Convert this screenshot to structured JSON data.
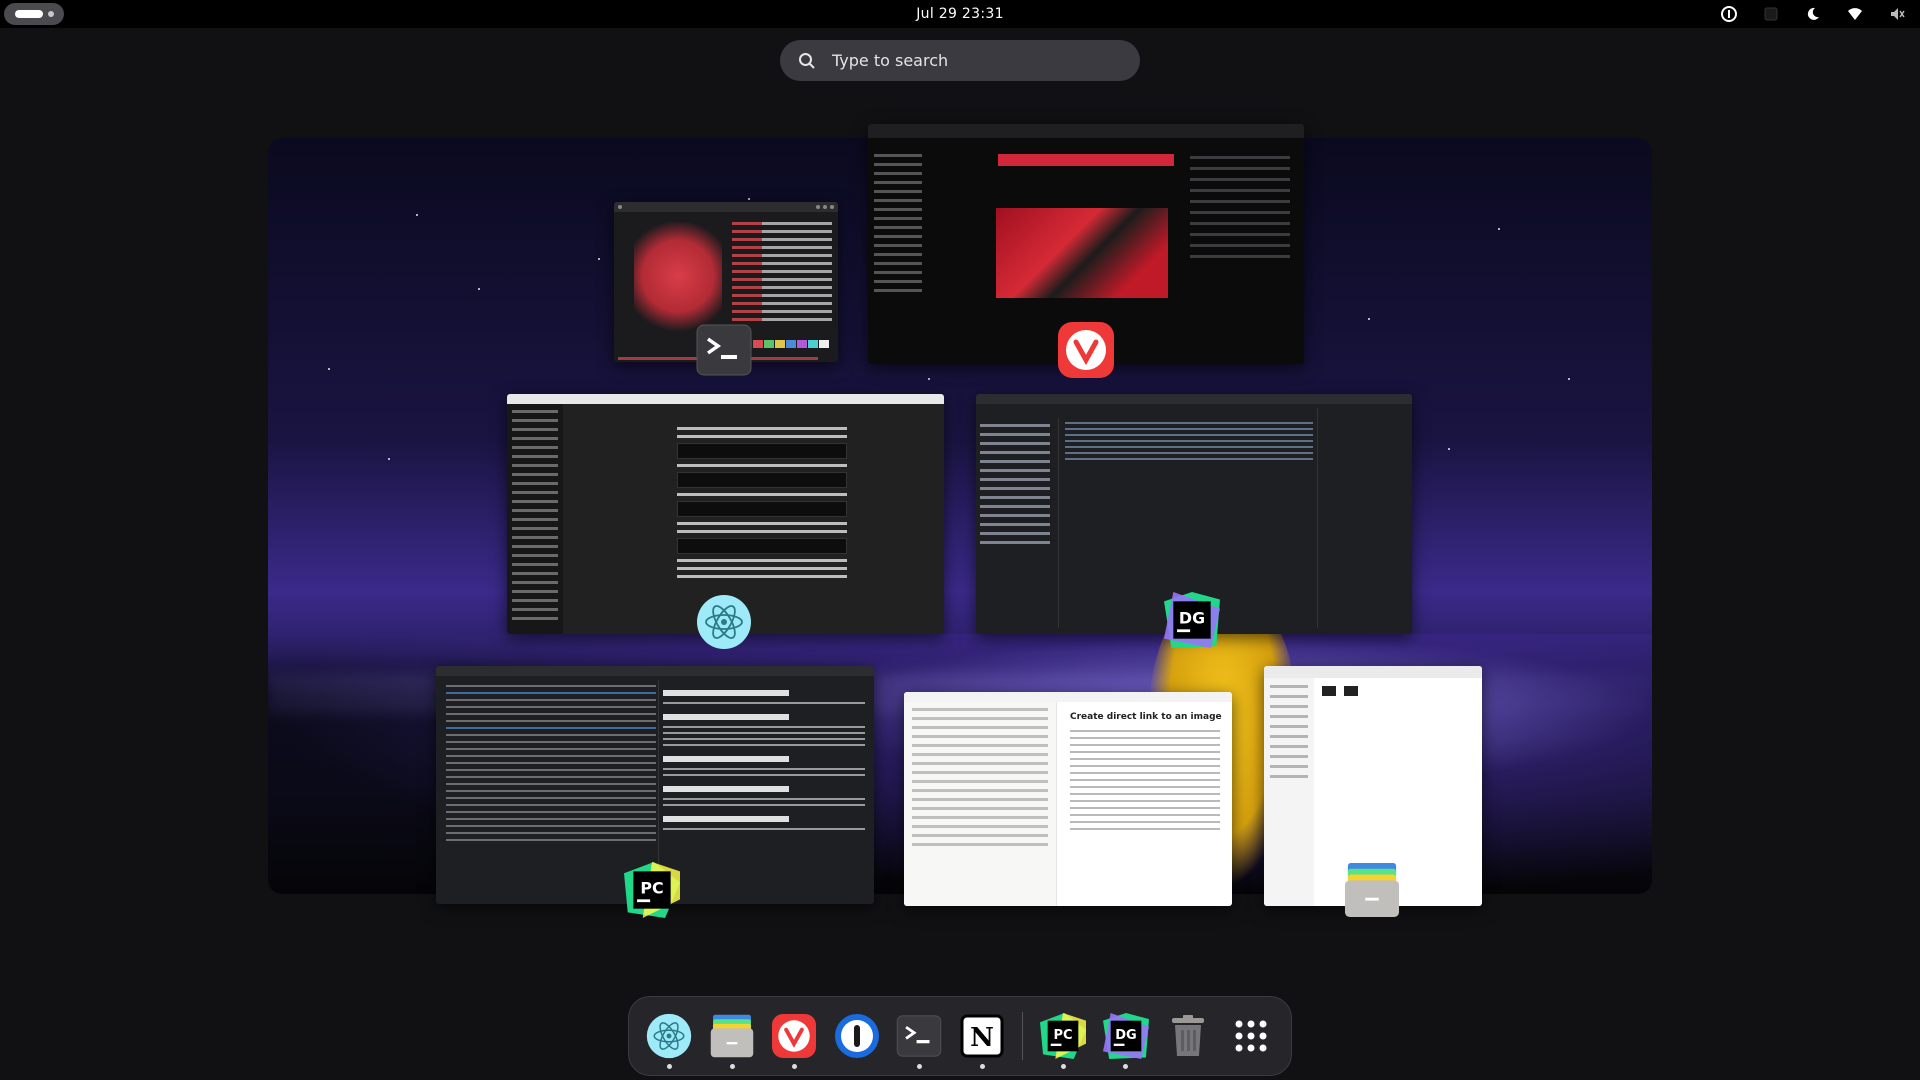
{
  "topbar": {
    "clock": "Jul 29  23:31",
    "tray_icons": [
      "password-manager-icon",
      "app-indicator-icon",
      "night-light-icon",
      "wifi-icon",
      "volume-muted-icon"
    ]
  },
  "search": {
    "placeholder": "Type to search"
  },
  "windows": {
    "notion": {
      "title": "Create direct link to an image"
    }
  },
  "dock": {
    "items": [
      "electron-app",
      "files",
      "vivaldi",
      "1password",
      "terminal",
      "notion",
      "pycharm",
      "datagrip",
      "trash",
      "show-apps"
    ]
  },
  "colors": {
    "accent_vivaldi": "#ef3939",
    "pycharm_green": "#21d789",
    "datagrip_purple": "#9775f8",
    "topbar": "#000000",
    "workspace_sky": "#2b1f66"
  }
}
